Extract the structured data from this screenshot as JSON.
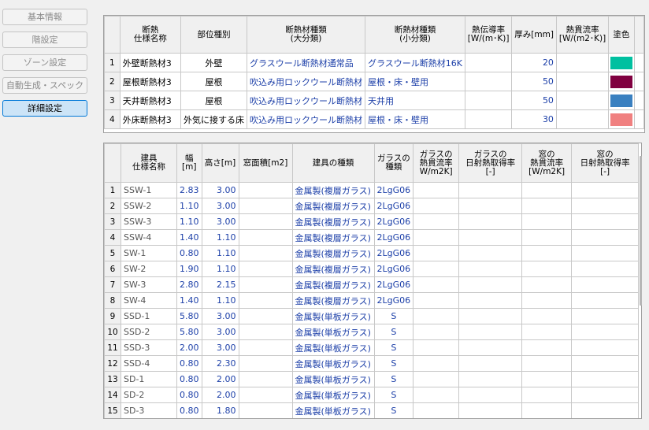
{
  "nav": [
    {
      "label": "基本情報",
      "active": false
    },
    {
      "label": "階設定",
      "active": false
    },
    {
      "label": "ゾーン設定",
      "active": false
    },
    {
      "label": "自動生成・スペック",
      "active": false
    },
    {
      "label": "詳細設定",
      "active": true
    }
  ],
  "insulation": {
    "headers": [
      "断熱\n仕様名称",
      "部位種別",
      "断熱材種類\n(大分類)",
      "断熱材種類\n(小分類)",
      "熱伝導率\n[W/(m･K)]",
      "厚み[mm]",
      "熱貫流率\n[W/(m2･K)]",
      "塗色"
    ],
    "rows": [
      {
        "num": "1",
        "name": "外壁断熱材3",
        "part": "外壁",
        "major": "グラスウール断熱材通常品",
        "minor": "グラスウール断熱材16K",
        "conductivity": "",
        "thickness": "20",
        "transmittance": "",
        "color": "#00c0a0"
      },
      {
        "num": "2",
        "name": "屋根断熱材3",
        "part": "屋根",
        "major": "吹込み用ロックウール断熱材",
        "minor": "屋根・床・壁用",
        "conductivity": "",
        "thickness": "50",
        "transmittance": "",
        "color": "#800040"
      },
      {
        "num": "3",
        "name": "天井断熱材3",
        "part": "屋根",
        "major": "吹込み用ロックウール断熱材",
        "minor": "天井用",
        "conductivity": "",
        "thickness": "50",
        "transmittance": "",
        "color": "#3a80c0"
      },
      {
        "num": "4",
        "name": "外床断熱材3",
        "part": "外気に接する床",
        "major": "吹込み用ロックウール断熱材",
        "minor": "屋根・床・壁用",
        "conductivity": "",
        "thickness": "30",
        "transmittance": "",
        "color": "#f08080"
      }
    ]
  },
  "fittings": {
    "headers": [
      "建具\n仕様名称",
      "幅[m]",
      "高さ[m]",
      "窓面積[m2]",
      "建具の種類",
      "ガラスの\n種類",
      "ガラスの\n熱貫流率\nW/m2K]",
      "ガラスの\n日射熱取得率\n[-]",
      "窓の\n熱貫流率\n[W/m2K]",
      "窓の\n日射熱取得率\n[-]"
    ],
    "rows": [
      {
        "num": "1",
        "name": "SSW-1",
        "width": "2.83",
        "height": "3.00",
        "area": "",
        "type": "金属製(複層ガラス)",
        "glass": "2LgG06"
      },
      {
        "num": "2",
        "name": "SSW-2",
        "width": "1.10",
        "height": "3.00",
        "area": "",
        "type": "金属製(複層ガラス)",
        "glass": "2LgG06"
      },
      {
        "num": "3",
        "name": "SSW-3",
        "width": "1.10",
        "height": "3.00",
        "area": "",
        "type": "金属製(複層ガラス)",
        "glass": "2LgG06"
      },
      {
        "num": "4",
        "name": "SSW-4",
        "width": "1.40",
        "height": "1.10",
        "area": "",
        "type": "金属製(複層ガラス)",
        "glass": "2LgG06"
      },
      {
        "num": "5",
        "name": "SW-1",
        "width": "0.80",
        "height": "1.10",
        "area": "",
        "type": "金属製(複層ガラス)",
        "glass": "2LgG06"
      },
      {
        "num": "6",
        "name": "SW-2",
        "width": "1.90",
        "height": "1.10",
        "area": "",
        "type": "金属製(複層ガラス)",
        "glass": "2LgG06"
      },
      {
        "num": "7",
        "name": "SW-3",
        "width": "2.80",
        "height": "2.15",
        "area": "",
        "type": "金属製(複層ガラス)",
        "glass": "2LgG06"
      },
      {
        "num": "8",
        "name": "SW-4",
        "width": "1.40",
        "height": "1.10",
        "area": "",
        "type": "金属製(複層ガラス)",
        "glass": "2LgG06"
      },
      {
        "num": "9",
        "name": "SSD-1",
        "width": "5.80",
        "height": "3.00",
        "area": "",
        "type": "金属製(単板ガラス)",
        "glass": "S"
      },
      {
        "num": "10",
        "name": "SSD-2",
        "width": "5.80",
        "height": "3.00",
        "area": "",
        "type": "金属製(単板ガラス)",
        "glass": "S"
      },
      {
        "num": "11",
        "name": "SSD-3",
        "width": "2.00",
        "height": "3.00",
        "area": "",
        "type": "金属製(単板ガラス)",
        "glass": "S"
      },
      {
        "num": "12",
        "name": "SSD-4",
        "width": "0.80",
        "height": "2.30",
        "area": "",
        "type": "金属製(単板ガラス)",
        "glass": "S"
      },
      {
        "num": "13",
        "name": "SD-1",
        "width": "0.80",
        "height": "2.00",
        "area": "",
        "type": "金属製(単板ガラス)",
        "glass": "S"
      },
      {
        "num": "14",
        "name": "SD-2",
        "width": "0.80",
        "height": "2.00",
        "area": "",
        "type": "金属製(単板ガラス)",
        "glass": "S"
      },
      {
        "num": "15",
        "name": "SD-3",
        "width": "0.80",
        "height": "1.80",
        "area": "",
        "type": "金属製(単板ガラス)",
        "glass": "S"
      }
    ]
  }
}
